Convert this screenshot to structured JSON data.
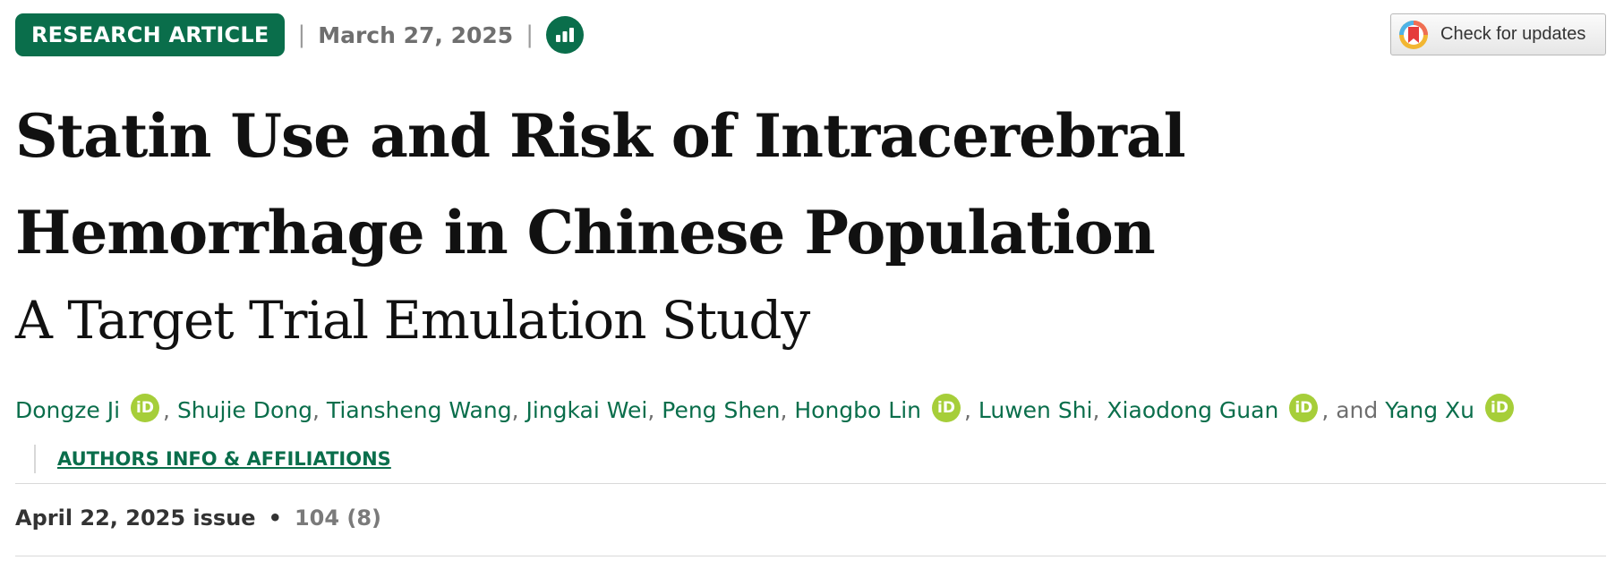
{
  "header": {
    "article_type": "RESEARCH ARTICLE",
    "date": "March 27, 2025",
    "separator": "|",
    "metrics_icon": "bar-chart-icon"
  },
  "check_updates": {
    "label": "Check for updates",
    "icon": "crossmark-icon"
  },
  "title": "Statin Use and Risk of Intracerebral Hemorrhage in Chinese Population",
  "subtitle": "A Target Trial Emulation Study",
  "authors": [
    {
      "name": "Dongze Ji",
      "orcid": true
    },
    {
      "name": "Shujie Dong",
      "orcid": false
    },
    {
      "name": "Tiansheng Wang",
      "orcid": false
    },
    {
      "name": "Jingkai Wei",
      "orcid": false
    },
    {
      "name": "Peng Shen",
      "orcid": false
    },
    {
      "name": "Hongbo Lin",
      "orcid": true
    },
    {
      "name": "Luwen Shi",
      "orcid": false
    },
    {
      "name": "Xiaodong Guan",
      "orcid": true
    },
    {
      "name": "Yang Xu",
      "orcid": true
    }
  ],
  "author_separators": {
    "comma": ", ",
    "and": ", and "
  },
  "orcid_label": "iD",
  "affiliations_link": "AUTHORS INFO & AFFILIATIONS",
  "issue": {
    "date": "April 22, 2025 issue",
    "bullet": "•",
    "volume": "104 (8)"
  },
  "colors": {
    "brand_green": "#0a6e4b",
    "orcid_green": "#a6ce39",
    "muted_text": "#6f6f6f"
  }
}
